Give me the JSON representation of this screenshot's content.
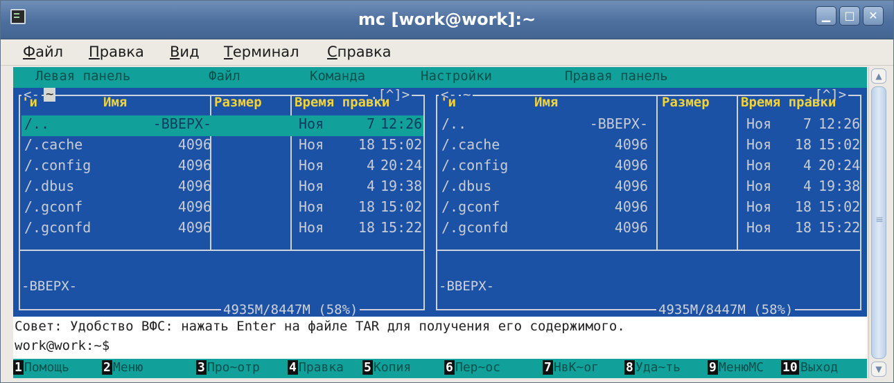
{
  "window": {
    "title": "mc [work@work]:~"
  },
  "menubar": [
    "Файл",
    "Правка",
    "Вид",
    "Терминал",
    "Справка"
  ],
  "mc_menu": [
    "Левая панель",
    "Файл",
    "Команда",
    "Настройки",
    "Правая панель"
  ],
  "left_panel": {
    "path": "~",
    "corner": ".[^]>",
    "columns": [
      "'и",
      "Имя",
      "Размер",
      "Время правки"
    ],
    "rows": [
      {
        "name": "/..",
        "size": "-ВВЕРХ-",
        "month": "Ноя",
        "day": "7",
        "time": "12:26"
      },
      {
        "name": "/.cache",
        "size": "4096",
        "month": "Ноя",
        "day": "18",
        "time": "15:02"
      },
      {
        "name": "/.config",
        "size": "4096",
        "month": "Ноя",
        "day": "4",
        "time": "20:24"
      },
      {
        "name": "/.dbus",
        "size": "4096",
        "month": "Ноя",
        "day": "4",
        "time": "19:38"
      },
      {
        "name": "/.gconf",
        "size": "4096",
        "month": "Ноя",
        "day": "18",
        "time": "15:02"
      },
      {
        "name": "/.gconfd",
        "size": "4096",
        "month": "Ноя",
        "day": "18",
        "time": "15:22"
      }
    ],
    "status": "-ВВЕРХ-",
    "disk": "4935M/8447M (58%)"
  },
  "right_panel": {
    "path": "~",
    "corner": ".[^]>",
    "columns": [
      "'и",
      "Имя",
      "Размер",
      "Время правки"
    ],
    "rows": [
      {
        "name": "/..",
        "size": "-ВВЕРХ-",
        "month": "Ноя",
        "day": "7",
        "time": "12:26"
      },
      {
        "name": "/.cache",
        "size": "4096",
        "month": "Ноя",
        "day": "18",
        "time": "15:02"
      },
      {
        "name": "/.config",
        "size": "4096",
        "month": "Ноя",
        "day": "4",
        "time": "20:24"
      },
      {
        "name": "/.dbus",
        "size": "4096",
        "month": "Ноя",
        "day": "4",
        "time": "19:38"
      },
      {
        "name": "/.gconf",
        "size": "4096",
        "month": "Ноя",
        "day": "18",
        "time": "15:02"
      },
      {
        "name": "/.gconfd",
        "size": "4096",
        "month": "Ноя",
        "day": "18",
        "time": "15:22"
      }
    ],
    "status": "-ВВЕРХ-",
    "disk": "4935M/8447M (58%)"
  },
  "hint": "Совет: Удобство ВФС: нажать Enter на файле TAR для получения его содержимого.",
  "prompt": "work@work:~$",
  "fkeys": [
    {
      "num": "1",
      "label": "Помощь"
    },
    {
      "num": "2",
      "label": "Меню"
    },
    {
      "num": "3",
      "label": "Про~отр"
    },
    {
      "num": "4",
      "label": "Правка"
    },
    {
      "num": "5",
      "label": "Копия"
    },
    {
      "num": "6",
      "label": "Пер~ос"
    },
    {
      "num": "7",
      "label": "НвК~ог"
    },
    {
      "num": "8",
      "label": "Уда~ть"
    },
    {
      "num": "9",
      "label": "МенюМС"
    },
    {
      "num": "10",
      "label": "Выход"
    }
  ],
  "icons": {
    "app": "terminal-icon",
    "minimize": "minimize-icon",
    "maximize": "maximize-icon",
    "close": "close-icon"
  },
  "colors": {
    "panel_bg": "#1c52a5",
    "accent_cyan": "#11a19a",
    "header_yellow": "#f3d33c",
    "titlebar": "#4d6f9e"
  }
}
